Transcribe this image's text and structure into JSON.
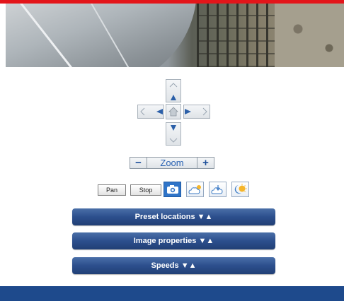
{
  "controls": {
    "zoom": {
      "minus": "−",
      "label": "Zoom",
      "plus": "+"
    },
    "pan_label": "Pan",
    "stop_label": "Stop"
  },
  "sections": [
    {
      "label": "Preset locations ▼▲"
    },
    {
      "label": "Image properties ▼▲"
    },
    {
      "label": "Speeds ▼▲"
    }
  ],
  "colors": {
    "top_bar": "#e3151a",
    "section_bar": "#2c4f8d",
    "footer": "#1e4a8c",
    "accent": "#2a63b3"
  },
  "icons": {
    "ptz_up": "arrow-up-icon",
    "ptz_down": "arrow-down-icon",
    "ptz_left": "arrow-left-icon",
    "ptz_right": "arrow-right-icon",
    "ptz_home": "home-icon",
    "snapshot": "camera-icon",
    "ir_on": "cloud-sun-icon",
    "ir_auto": "cloud-hand-icon",
    "night": "moon-sun-icon"
  }
}
